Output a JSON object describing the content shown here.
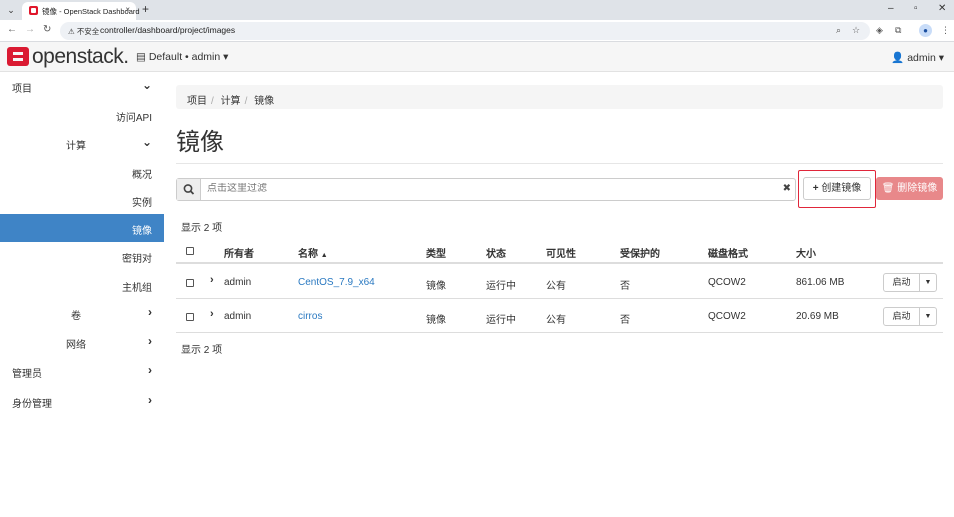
{
  "browser": {
    "tab_title": "镜像 - OpenStack Dashboard",
    "tab_close": "×",
    "new_tab": "+",
    "insecure_label": "不安全",
    "url": "controller/dashboard/project/images",
    "window_controls": [
      "–",
      "▫",
      "✕"
    ]
  },
  "header": {
    "logo_text": "openstack.",
    "project_selector": "Default • admin",
    "user_menu": "admin"
  },
  "sidebar": {
    "items": [
      {
        "label": "项目",
        "chevron": "down"
      },
      {
        "label": "访问API"
      },
      {
        "label": "计算",
        "chevron": "down"
      },
      {
        "label": "概况"
      },
      {
        "label": "实例"
      },
      {
        "label": "镜像",
        "active": true
      },
      {
        "label": "密钥对"
      },
      {
        "label": "主机组"
      },
      {
        "label": "卷",
        "chevron": "right"
      },
      {
        "label": "网络",
        "chevron": "right"
      },
      {
        "label": "管理员",
        "chevron": "right"
      },
      {
        "label": "身份管理",
        "chevron": "right"
      }
    ]
  },
  "breadcrumb": [
    "项目",
    "计算",
    "镜像"
  ],
  "page_title": "镜像",
  "filter": {
    "placeholder": "点击这里过滤",
    "value": "",
    "clear": "✖"
  },
  "actions": {
    "create_label": "创建镜像",
    "delete_label": "删除镜像"
  },
  "display_count": "显示 2 项",
  "table": {
    "columns": [
      "所有者",
      "名称",
      "类型",
      "状态",
      "可见性",
      "受保护的",
      "磁盘格式",
      "大小"
    ],
    "sort_indicator": "▲",
    "rows": [
      {
        "owner": "admin",
        "name": "CentOS_7.9_x64",
        "type": "镜像",
        "status": "运行中",
        "visibility": "公有",
        "protected": "否",
        "disk_format": "QCOW2",
        "size": "861.06 MB",
        "action": "启动"
      },
      {
        "owner": "admin",
        "name": "cirros",
        "type": "镜像",
        "status": "运行中",
        "visibility": "公有",
        "protected": "否",
        "disk_format": "QCOW2",
        "size": "20.69 MB",
        "action": "启动"
      }
    ]
  },
  "colors": {
    "accent": "#3f84c6",
    "link": "#2a79c1",
    "danger": "#e8888a",
    "highlight": "#e0263a",
    "logo": "#da1a32"
  }
}
